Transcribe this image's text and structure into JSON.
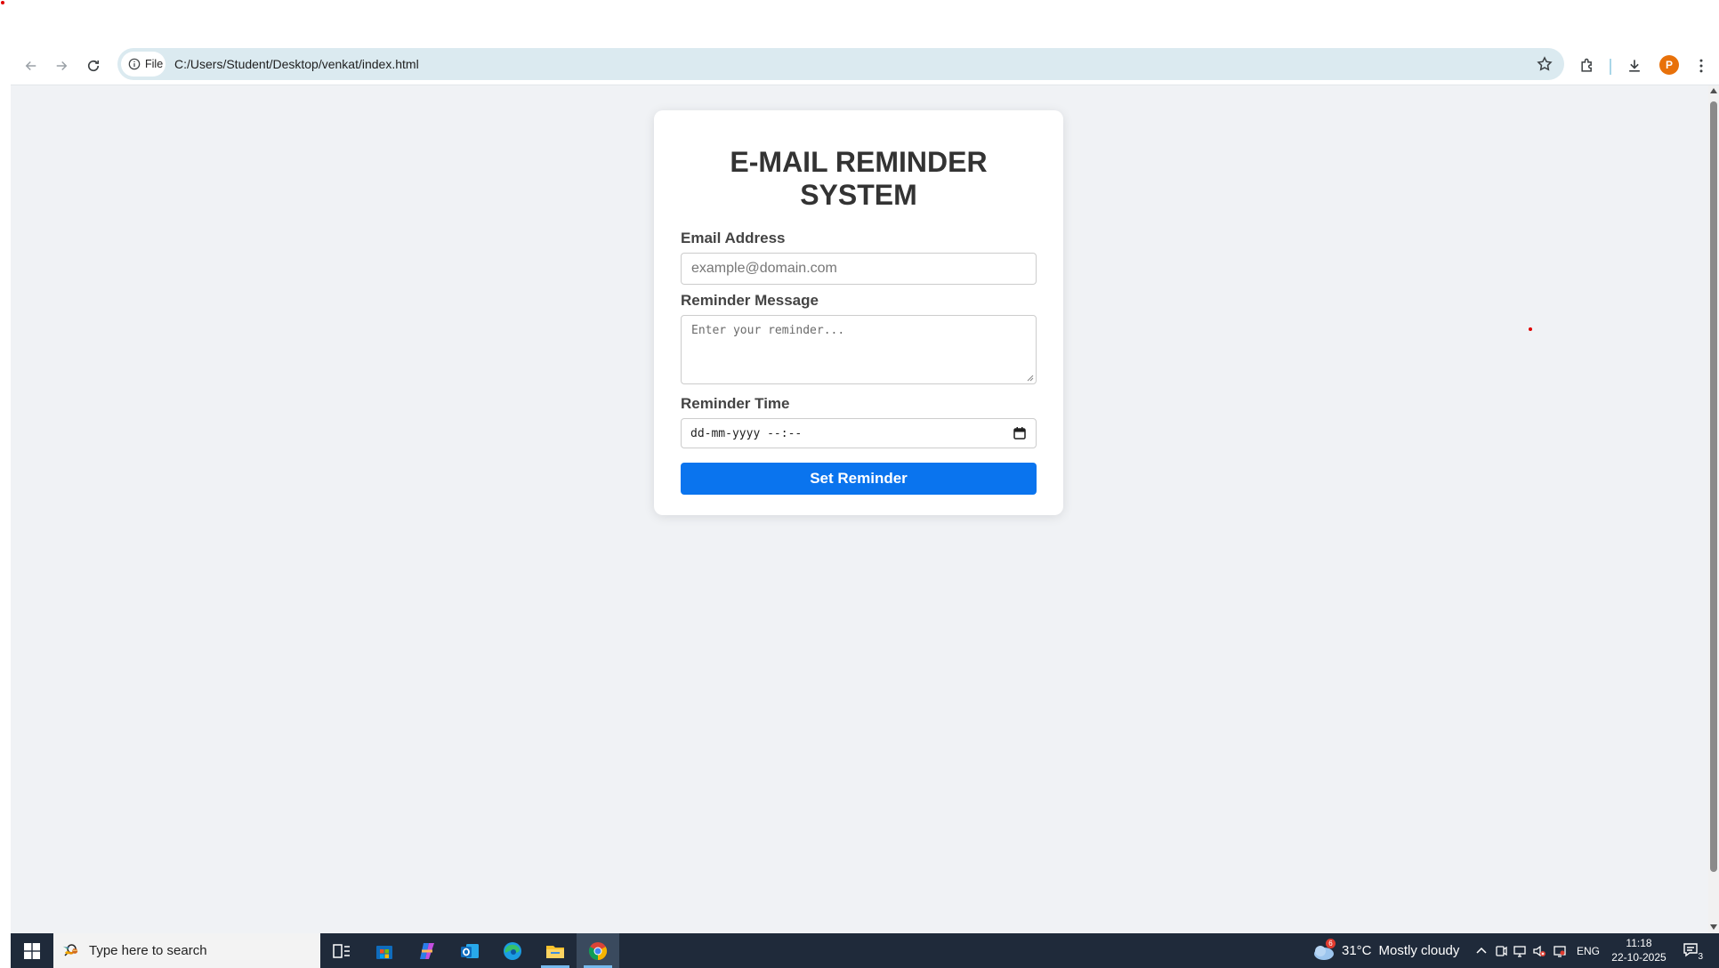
{
  "browser": {
    "site_chip": "File",
    "url": "C:/Users/Student/Desktop/venkat/index.html"
  },
  "form": {
    "title_line1": "E-MAIL REMINDER",
    "title_line2": "SYSTEM",
    "email_label": "Email Address",
    "email_placeholder": "example@domain.com",
    "message_label": "Reminder Message",
    "message_placeholder": "Enter your reminder...",
    "time_label": "Reminder Time",
    "time_placeholder": "dd-mm-yyyy --:--",
    "submit_label": "Set Reminder"
  },
  "taskbar": {
    "search_placeholder": "Type here to search",
    "weather_badge": "6",
    "weather_temp": "31°C",
    "weather_desc": "Mostly cloudy",
    "language": "ENG",
    "time": "11:18",
    "date": "22-10-2025",
    "notification_count": "3"
  },
  "colors": {
    "accent": "#0a74ee",
    "page_bg": "#f0f2f5",
    "avatar": "#e8710a",
    "taskbar": "#1f2a3a"
  },
  "profile": {
    "initial": "P"
  }
}
